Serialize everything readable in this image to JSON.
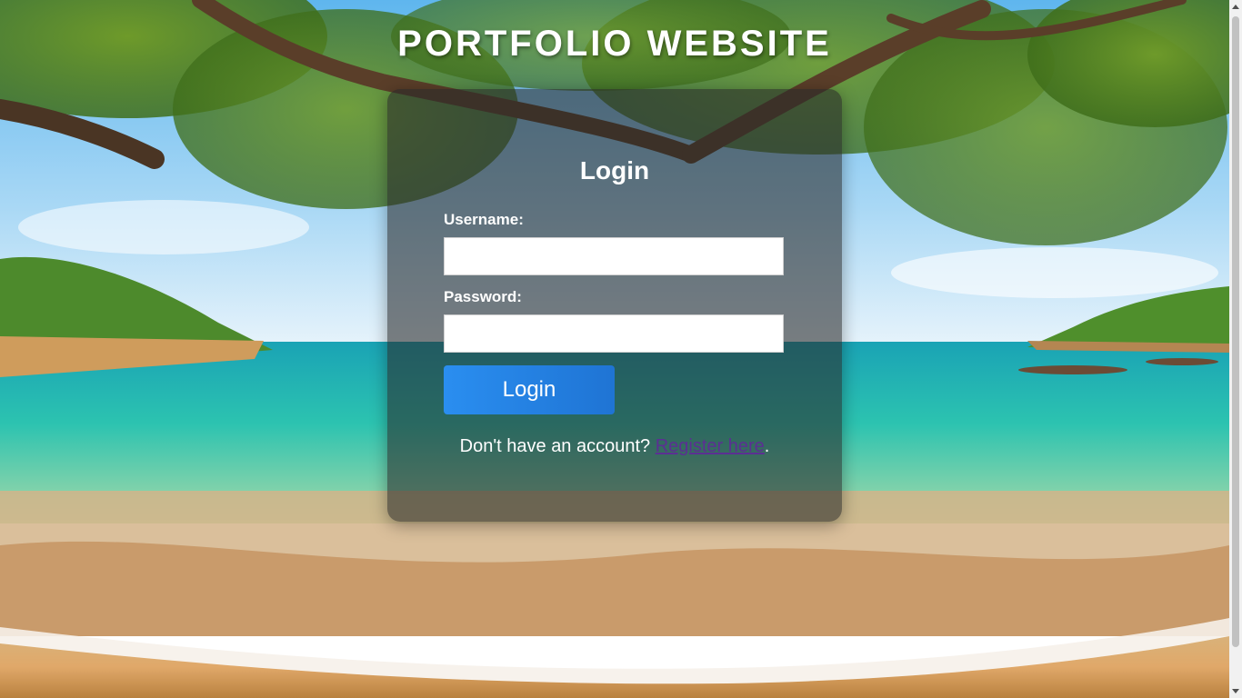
{
  "header": {
    "title": "PORTFOLIO WEBSITE"
  },
  "login_form": {
    "heading": "Login",
    "username_label": "Username:",
    "username_value": "",
    "password_label": "Password:",
    "password_value": "",
    "submit_label": "Login",
    "register_prompt": "Don't have an account?",
    "register_link_text": "Register here",
    "register_suffix": "."
  },
  "colors": {
    "button_gradient_start": "#2a8ef0",
    "button_gradient_end": "#1f74d4",
    "link_color": "#5b2f93",
    "card_overlay": "rgba(40,40,40,0.58)"
  },
  "background": {
    "scene": "tropical-beach-under-tree"
  }
}
